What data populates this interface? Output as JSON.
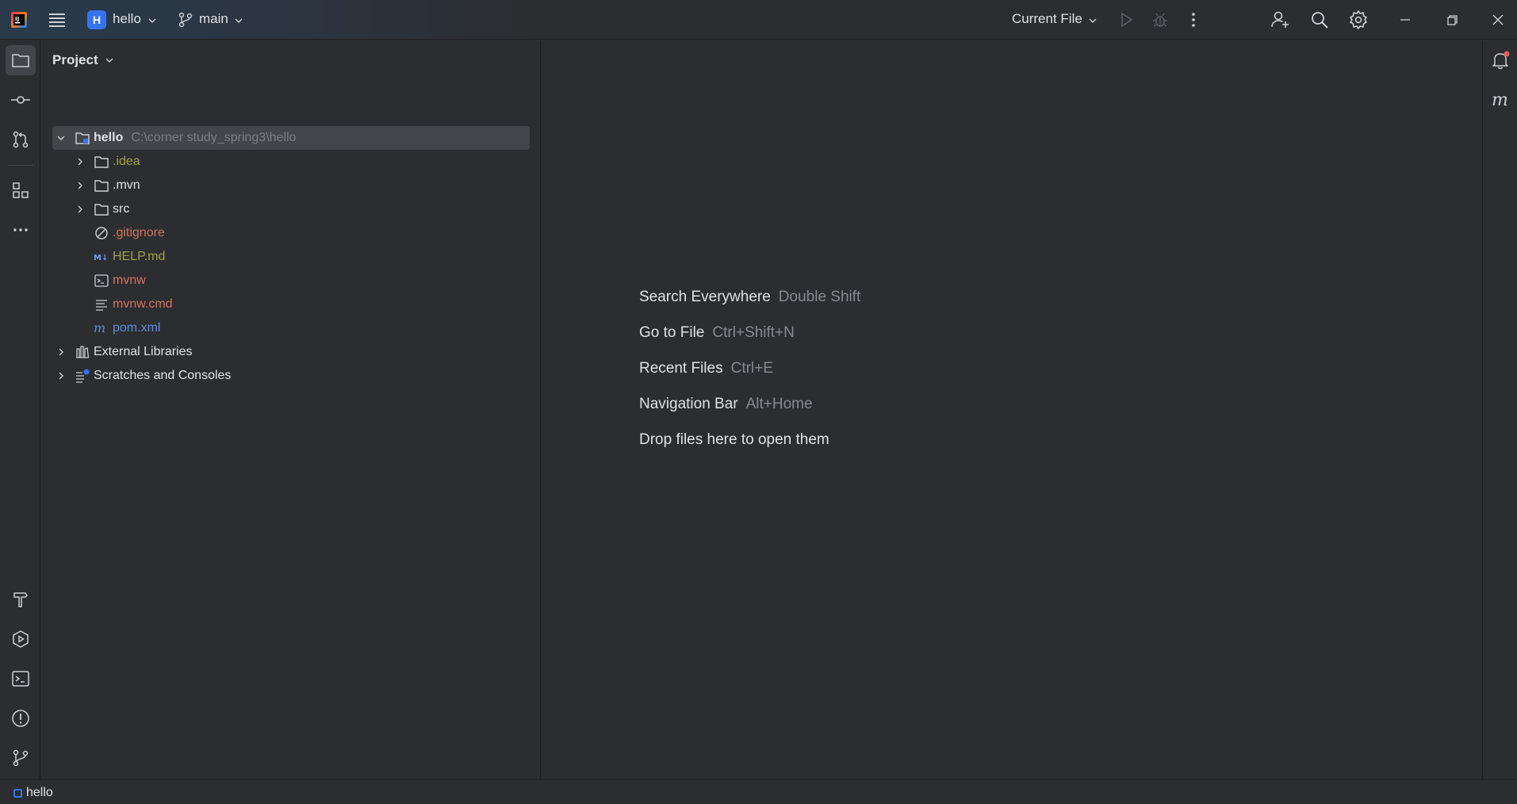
{
  "titlebar": {
    "project_badge": "H",
    "project_name": "hello",
    "branch_name": "main",
    "run_config": "Current File"
  },
  "project_panel": {
    "title": "Project",
    "root": {
      "name": "hello",
      "path": "C:\\corner study_spring3\\hello"
    },
    "items": [
      {
        "name": ".idea",
        "type": "folder",
        "color": "#a2a24a"
      },
      {
        "name": ".mvn",
        "type": "folder",
        "color": "#dfe1e5"
      },
      {
        "name": "src",
        "type": "folder",
        "color": "#dfe1e5"
      },
      {
        "name": ".gitignore",
        "type": "ignore-file",
        "color": "#d5735a"
      },
      {
        "name": "HELP.md",
        "type": "markdown-file",
        "color": "#a2a24a"
      },
      {
        "name": "mvnw",
        "type": "shell-file",
        "color": "#d5735a"
      },
      {
        "name": "mvnw.cmd",
        "type": "text-file",
        "color": "#d5735a"
      },
      {
        "name": "pom.xml",
        "type": "maven-file",
        "color": "#5e8ee0"
      }
    ],
    "external_libraries": "External Libraries",
    "scratches": "Scratches and Consoles"
  },
  "editor_hints": [
    {
      "label": "Search Everywhere",
      "key": "Double Shift"
    },
    {
      "label": "Go to File",
      "key": "Ctrl+Shift+N"
    },
    {
      "label": "Recent Files",
      "key": "Ctrl+E"
    },
    {
      "label": "Navigation Bar",
      "key": "Alt+Home"
    },
    {
      "label": "Drop files here to open them",
      "key": ""
    }
  ],
  "statusbar": {
    "text": "hello"
  },
  "colors": {
    "accent": "#3574f0",
    "background": "#2b2d30",
    "notification_dot": "#e55b5b"
  }
}
